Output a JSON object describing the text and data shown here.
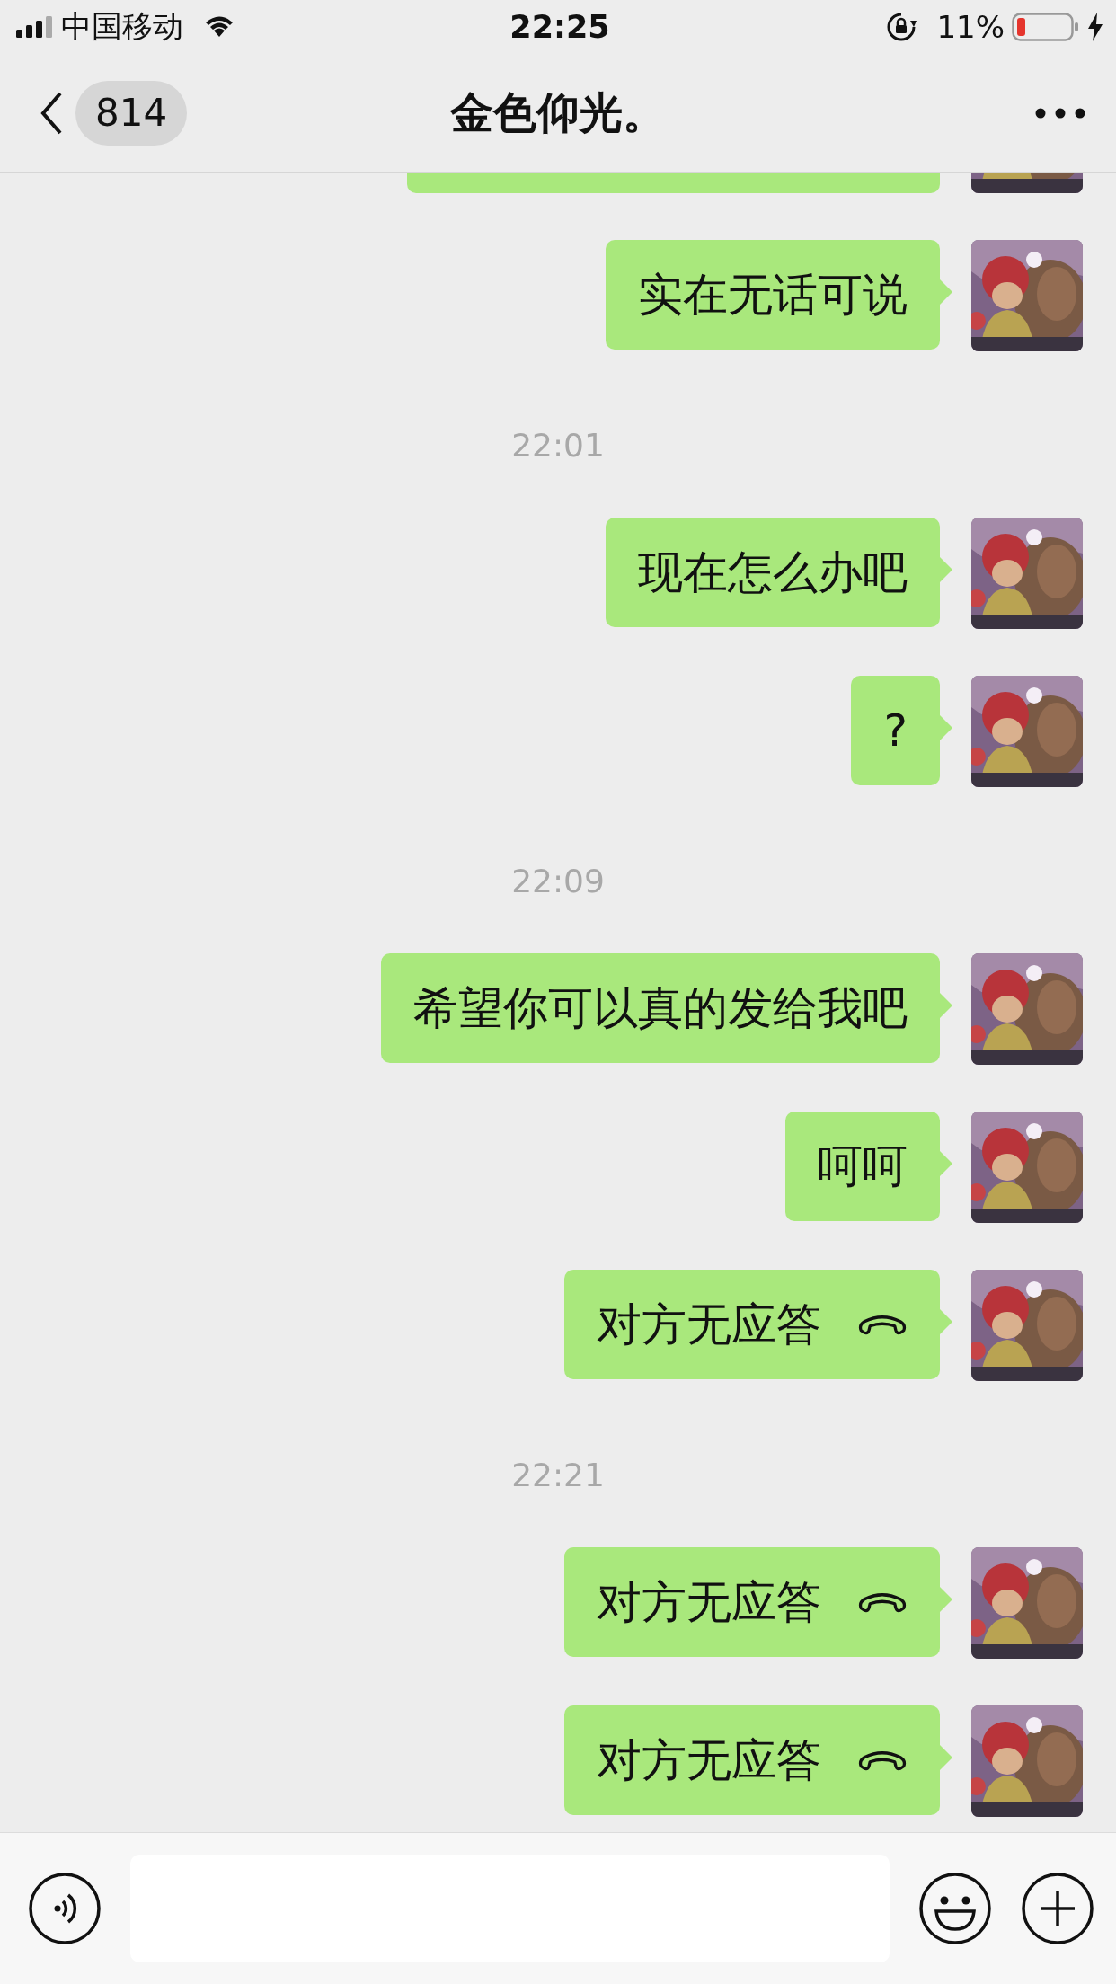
{
  "status_bar": {
    "carrier": "中国移动",
    "time": "22:25",
    "battery_text": "11%"
  },
  "nav": {
    "back_badge": "814",
    "title": "金色仰光。"
  },
  "messages": [
    {
      "kind": "cut"
    },
    {
      "kind": "text",
      "text": "实在无话可说"
    },
    {
      "kind": "time",
      "text": "22:01"
    },
    {
      "kind": "text",
      "text": "现在怎么办吧"
    },
    {
      "kind": "text",
      "text": "?"
    },
    {
      "kind": "time",
      "text": "22:09"
    },
    {
      "kind": "text",
      "text": "希望你可以真的发给我吧"
    },
    {
      "kind": "text",
      "text": "呵呵"
    },
    {
      "kind": "call",
      "text": "对方无应答"
    },
    {
      "kind": "time",
      "text": "22:21"
    },
    {
      "kind": "call",
      "text": "对方无应答"
    },
    {
      "kind": "call",
      "text": "对方无应答"
    }
  ]
}
